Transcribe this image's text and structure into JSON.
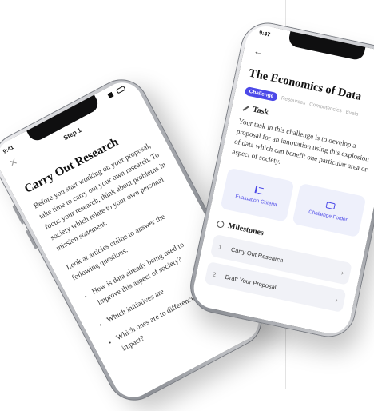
{
  "left_screen": {
    "time": "9:41",
    "step_label": "Step 1",
    "title": "Carry Out Research",
    "paragraph_1": "Before you start working on your proposal, take time to carry out your own research. To focus your research, think about problems in society which relate to your own personal mission statement.",
    "paragraph_2": "Look at articles online to answer the following questions.",
    "bullets": [
      "How is data already being used to improve this aspect of society?",
      "Which initiatives are",
      "Which ones are to difference and has impact?"
    ]
  },
  "right_screen": {
    "time": "9:47",
    "title": "The Economics of Data",
    "tabs": [
      "Challenge",
      "Resources",
      "Competencies",
      "Evals"
    ],
    "task_heading": "Task",
    "task_body": "Your task in this challenge is to develop a proposal for an innovation using this explosion of data which can benefit one particular area or aspect of society.",
    "cards": [
      {
        "label": "Evaluation Criteria",
        "icon": "list-icon"
      },
      {
        "label": "Challenge Folder",
        "icon": "folder-icon"
      }
    ],
    "milestones_heading": "Milestones",
    "milestones": [
      {
        "num": "1",
        "label": "Carry Out Research"
      },
      {
        "num": "2",
        "label": "Draft Your Proposal"
      }
    ]
  }
}
